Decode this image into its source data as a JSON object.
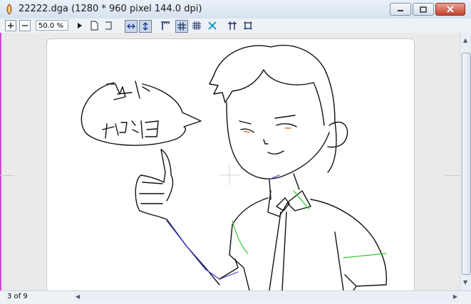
{
  "window": {
    "title": "22222.dga (1280 * 960 pixel 144.0 dpi)",
    "buttons": [
      "minimize",
      "maximize",
      "close"
    ]
  },
  "toolbar": {
    "zoom_value": "50.0 %",
    "tools": [
      "zoom-in",
      "zoom-out",
      "zoom-play",
      "page-portrait",
      "page-fold",
      "fit-width",
      "fit-height",
      "ruler",
      "grid",
      "grid-small",
      "fit-window",
      "guide",
      "frame"
    ]
  },
  "drawing": {
    "speech_text_line1": "马上",
    "speech_text_line2": "加油"
  },
  "status": {
    "pages": "3 of 9"
  },
  "colors": {
    "ink": "#111111",
    "blue_line": "#3a3ad0",
    "green_line": "#2ec82e",
    "accent_magenta": "#d04ad6"
  }
}
